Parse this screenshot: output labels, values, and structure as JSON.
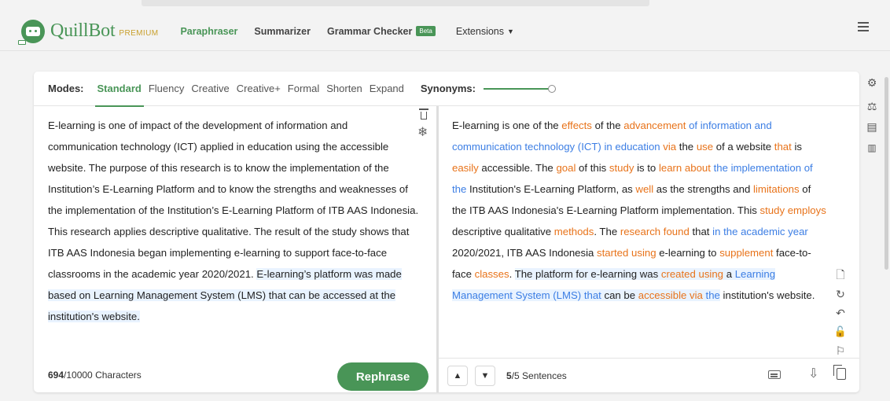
{
  "header": {
    "brand_name": "QuillBot",
    "brand_tier": "PREMIUM",
    "nav": [
      {
        "label": "Paraphraser"
      },
      {
        "label": "Summarizer"
      },
      {
        "label": "Grammar Checker",
        "badge": "Beta"
      },
      {
        "label": "Extensions"
      }
    ],
    "menu_icon": "hamburger-menu-icon"
  },
  "modes": {
    "label": "Modes:",
    "items": [
      "Standard",
      "Fluency",
      "Creative",
      "Creative+",
      "Formal",
      "Shorten",
      "Expand"
    ],
    "active": "Standard",
    "synonyms_label": "Synonyms:",
    "synonyms_level": 1.0
  },
  "input": {
    "segments": [
      {
        "text": "E-learning is one of impact of the development of information and communication technology (ICT) applied in education using the accessible website. The purpose of this research is to know the implementation of the Institution’s E-Learning Platform and to know the strengths and weaknesses of the implementation of the Institution’s E-Learning Platform of ITB AAS Indonesia. This research applies descriptive qualitative. The result of the study shows that ITB AAS Indonesia began implementing e-learning to support face-to-face classrooms in the academic year 2020/2021. ",
        "highlight": false
      },
      {
        "text": "E-learning’s platform was made based on Learning Management System (LMS) that can be accessed at the institution's website.",
        "highlight": true
      }
    ],
    "char_count": "694",
    "char_limit": "/10000 Characters",
    "rephrase_label": "Rephrase"
  },
  "output": {
    "segments": [
      {
        "text": "E-learning is one of the ",
        "style": "plain"
      },
      {
        "text": "effects",
        "style": "changed"
      },
      {
        "text": " of the ",
        "style": "plain"
      },
      {
        "text": "advancement",
        "style": "changed"
      },
      {
        "text": " of information and communication technology (ICT) in education ",
        "style": "structure"
      },
      {
        "text": "via",
        "style": "changed"
      },
      {
        "text": " the ",
        "style": "plain"
      },
      {
        "text": "use",
        "style": "changed"
      },
      {
        "text": " of a website ",
        "style": "plain"
      },
      {
        "text": "that",
        "style": "changed"
      },
      {
        "text": " is ",
        "style": "plain"
      },
      {
        "text": "easily",
        "style": "changed"
      },
      {
        "text": " accessible. The ",
        "style": "plain"
      },
      {
        "text": "goal",
        "style": "changed"
      },
      {
        "text": " of this ",
        "style": "plain"
      },
      {
        "text": "study",
        "style": "changed"
      },
      {
        "text": " is to ",
        "style": "plain"
      },
      {
        "text": "learn about",
        "style": "changed"
      },
      {
        "text": " the implementation of the ",
        "style": "structure"
      },
      {
        "text": "Institution's E-Learning Platform, as ",
        "style": "plain"
      },
      {
        "text": "well",
        "style": "changed"
      },
      {
        "text": " as the strengths and ",
        "style": "plain"
      },
      {
        "text": "limitations",
        "style": "changed"
      },
      {
        "text": " of the ITB AAS Indonesia's E-Learning Platform implementation. This ",
        "style": "plain"
      },
      {
        "text": "study employs",
        "style": "changed"
      },
      {
        "text": " descriptive qualitative ",
        "style": "plain"
      },
      {
        "text": "methods",
        "style": "changed"
      },
      {
        "text": ". The ",
        "style": "plain"
      },
      {
        "text": "research found",
        "style": "changed"
      },
      {
        "text": " that ",
        "style": "plain"
      },
      {
        "text": "in the academic year",
        "style": "structure"
      },
      {
        "text": " 2020/2021, ITB AAS Indonesia ",
        "style": "plain"
      },
      {
        "text": "started using",
        "style": "changed"
      },
      {
        "text": " e-learning to ",
        "style": "plain"
      },
      {
        "text": "supplement",
        "style": "changed"
      },
      {
        "text": " face-to-face ",
        "style": "plain"
      },
      {
        "text": "classes",
        "style": "changed"
      },
      {
        "text": ". ",
        "style": "plain"
      },
      {
        "text": "The platform for e-learning was ",
        "style": "sel"
      },
      {
        "text": "created using",
        "style": "selchanged"
      },
      {
        "text": " a ",
        "style": "sel"
      },
      {
        "text": "Learning Management System (LMS) that",
        "style": "selstructure"
      },
      {
        "text": " can be ",
        "style": "sel"
      },
      {
        "text": "accessible",
        "style": "selchanged"
      },
      {
        "text": " ",
        "style": "sel"
      },
      {
        "text": "via",
        "style": "selchanged"
      },
      {
        "text": " ",
        "style": "sel"
      },
      {
        "text": "the",
        "style": "selstructure"
      },
      {
        "text": " institution's website.",
        "style": "plain"
      }
    ],
    "sentence_current": "5",
    "sentence_total": "/5 Sentences"
  },
  "colors": {
    "brand_green": "#499557",
    "changed_word": "#e8731a",
    "structure_change": "#3c7ee4",
    "highlight_bg": "#e9f3ff"
  },
  "icons": {
    "rail": [
      "gear-icon",
      "compare-icon",
      "comment-icon",
      "stats-icon"
    ],
    "side_tools": [
      "document-icon",
      "refresh-icon",
      "undo-icon",
      "lock-icon",
      "flag-icon"
    ],
    "editor": [
      "trash-icon",
      "freeze-icon",
      "keyboard-icon",
      "download-icon",
      "copy-icon"
    ]
  }
}
